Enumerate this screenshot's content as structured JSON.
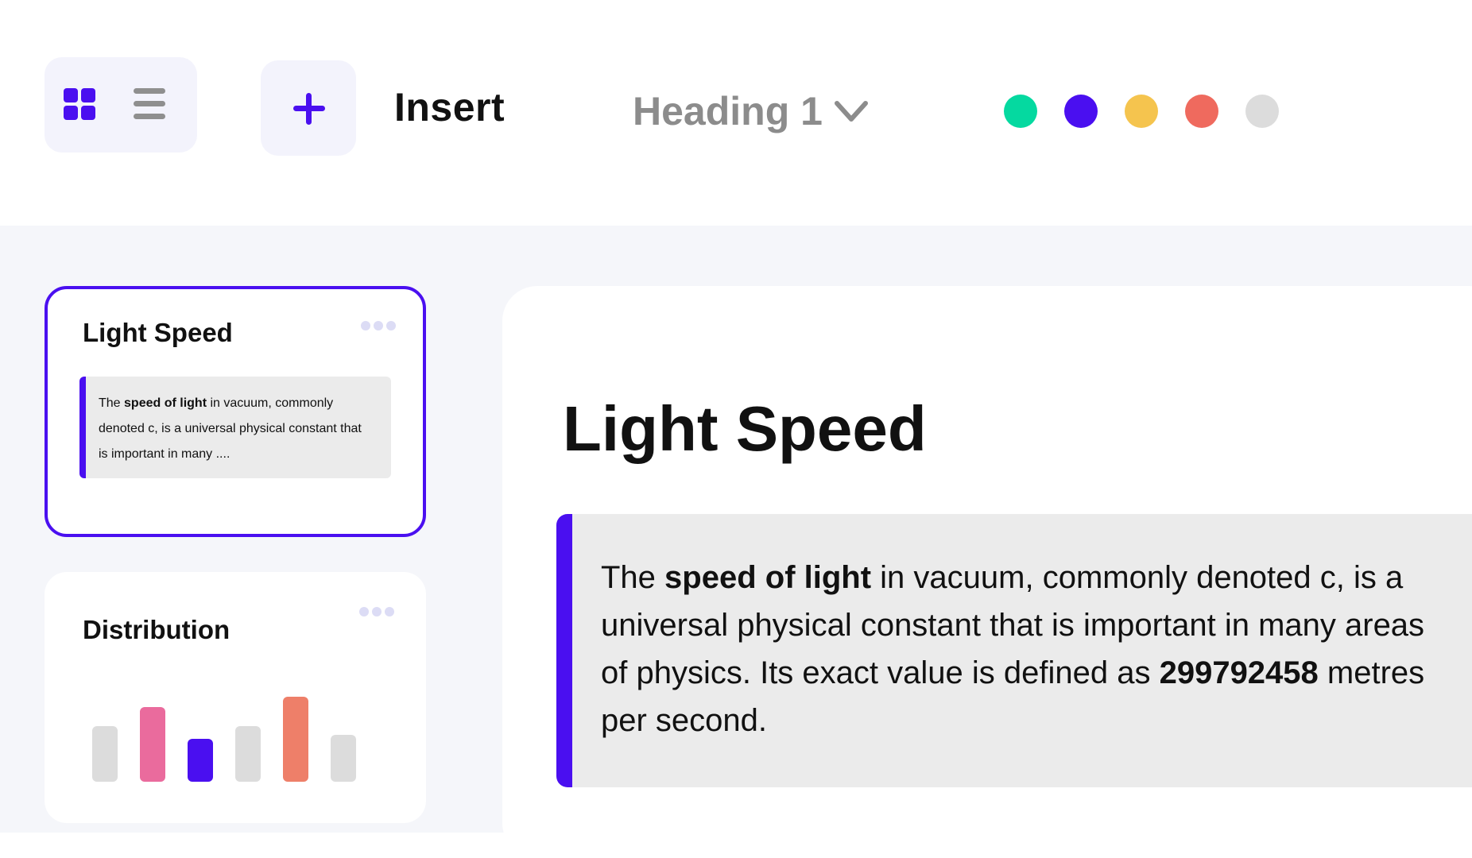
{
  "toolbar": {
    "insert_label": "Insert",
    "heading_select": {
      "value": "Heading 1"
    },
    "icons": [
      "grid-view-icon",
      "list-view-icon",
      "plus-icon",
      "chevron-down-icon"
    ],
    "colors": [
      {
        "name": "green",
        "hex": "#05d9a0"
      },
      {
        "name": "purple",
        "hex": "#4a0ff0"
      },
      {
        "name": "yellow",
        "hex": "#f5c44e"
      },
      {
        "name": "red",
        "hex": "#ef6a5e"
      },
      {
        "name": "gray",
        "hex": "#dcdcdc"
      }
    ]
  },
  "cards": [
    {
      "title": "Light Speed",
      "preview": {
        "pre": "The ",
        "bold": "speed of light",
        "post": " in vacuum, commonly denoted c, is a universal physical constant that is important in many ...."
      }
    },
    {
      "title": "Distribution",
      "chart_data": {
        "type": "bar",
        "title": "",
        "values": [
          52,
          70,
          40,
          52,
          80,
          44
        ],
        "ylim": [
          0,
          100
        ],
        "colors": [
          "#dcdcdc",
          "#ea6b9d",
          "#4a0ff0",
          "#dcdcdc",
          "#ee7f69",
          "#dcdcdc"
        ],
        "grid": false
      }
    }
  ],
  "editor": {
    "title": "Light Speed",
    "quote": {
      "pre": "The ",
      "bold1": "speed of light",
      "mid": " in vacuum, commonly denoted c, is a universal physical constant that is important in many areas of physics. Its exact value is defined as ",
      "bold2": "299792458",
      "post": " metres per second."
    }
  },
  "accent_color": "#4a0ff0"
}
